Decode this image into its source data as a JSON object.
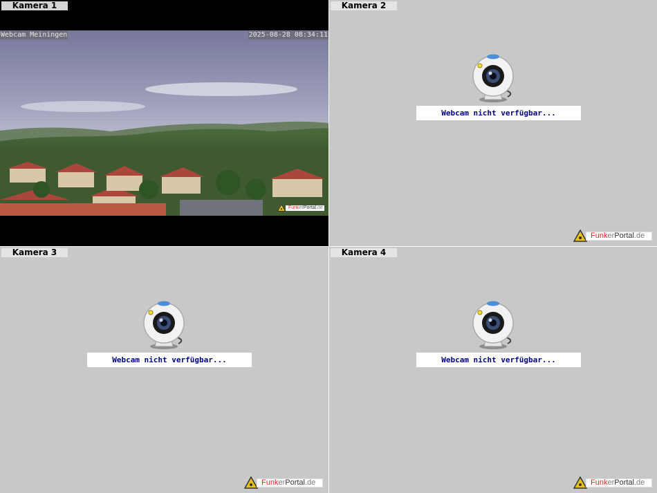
{
  "cameras": [
    {
      "label": "Kamera 1",
      "overlay_left": "Webcam Meiningen",
      "overlay_right": "2025-08-28 08:34:11",
      "logo": {
        "part1": "Funk",
        "part2": "er",
        "part3": "Portal",
        "part4": ".de"
      }
    },
    {
      "label": "Kamera 2",
      "status": "Webcam nicht verfügbar...",
      "logo": {
        "part1": "Funk",
        "part2": "er",
        "part3": "Portal",
        "part4": ".de"
      }
    },
    {
      "label": "Kamera 3",
      "status": "Webcam nicht verfügbar...",
      "logo": {
        "part1": "Funk",
        "part2": "er",
        "part3": "Portal",
        "part4": ".de"
      }
    },
    {
      "label": "Kamera 4",
      "status": "Webcam nicht verfügbar...",
      "logo": {
        "part1": "Funk",
        "part2": "er",
        "part3": "Portal",
        "part4": ".de"
      }
    }
  ],
  "colors": {
    "panel_bg": "#c8c8c8",
    "status_text": "#000080",
    "logo_red": "#e02020"
  },
  "icons": {
    "placeholder": "webcam-icon",
    "logo": "warning-triangle-icon"
  }
}
